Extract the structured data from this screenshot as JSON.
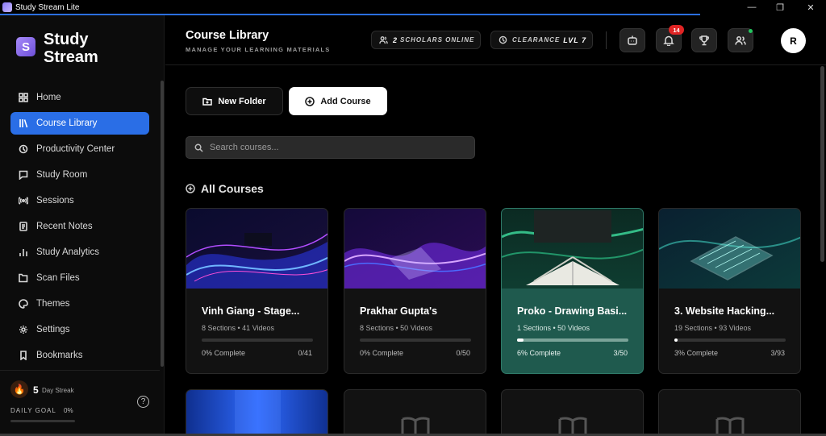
{
  "window": {
    "title": "Study Stream Lite"
  },
  "brand": {
    "line1": "Study",
    "line2": "Stream"
  },
  "sidebar": {
    "items": [
      {
        "label": "Home",
        "icon": "grid-icon"
      },
      {
        "label": "Course Library",
        "icon": "library-icon",
        "active": true
      },
      {
        "label": "Productivity Center",
        "icon": "clearance-icon"
      },
      {
        "label": "Study Room",
        "icon": "chat-icon"
      },
      {
        "label": "Sessions",
        "icon": "broadcast-icon"
      },
      {
        "label": "Recent Notes",
        "icon": "note-icon"
      },
      {
        "label": "Study Analytics",
        "icon": "chart-icon"
      },
      {
        "label": "Scan Files",
        "icon": "scan-icon"
      },
      {
        "label": "Themes",
        "icon": "theme-icon"
      },
      {
        "label": "Settings",
        "icon": "gear-icon"
      },
      {
        "label": "Bookmarks",
        "icon": "bookmark-icon"
      }
    ],
    "streak": {
      "value": "5",
      "label": "Day Streak"
    },
    "goal": {
      "label": "DAILY GOAL",
      "value": "0%",
      "progress": 0
    },
    "help": "?"
  },
  "header": {
    "title": "Course Library",
    "subtitle": "MANAGE YOUR LEARNING MATERIALS",
    "scholars": {
      "count": "2",
      "label": "SCHOLARS ONLINE"
    },
    "clearance": {
      "label": "CLEARANCE",
      "level": "LVL 7"
    },
    "notifications": "14",
    "avatar": "R"
  },
  "actions": {
    "new_folder": "New Folder",
    "add_course": "Add Course"
  },
  "search": {
    "placeholder": "Search courses..."
  },
  "section": {
    "title": "All Courses"
  },
  "courses": [
    {
      "title": "Vinh Giang - Stage...",
      "meta": "8 Sections • 41 Videos",
      "pct": "0% Complete",
      "count": "0/41",
      "progress": 0
    },
    {
      "title": "Prakhar Gupta's",
      "meta": "8 Sections • 50 Videos",
      "pct": "0% Complete",
      "count": "0/50",
      "progress": 0
    },
    {
      "title": "Proko - Drawing Basi...",
      "meta": "1 Sections • 50 Videos",
      "pct": "6% Complete",
      "count": "3/50",
      "progress": 0.06
    },
    {
      "title": "3. Website Hacking...",
      "meta": "19 Sections • 93 Videos",
      "pct": "3% Complete",
      "count": "3/93",
      "progress": 0.032
    }
  ],
  "colors": {
    "accent": "#2a6ee6",
    "highlight_card": "#1f5a4e",
    "badge": "#e02424",
    "online": "#22c55e"
  }
}
